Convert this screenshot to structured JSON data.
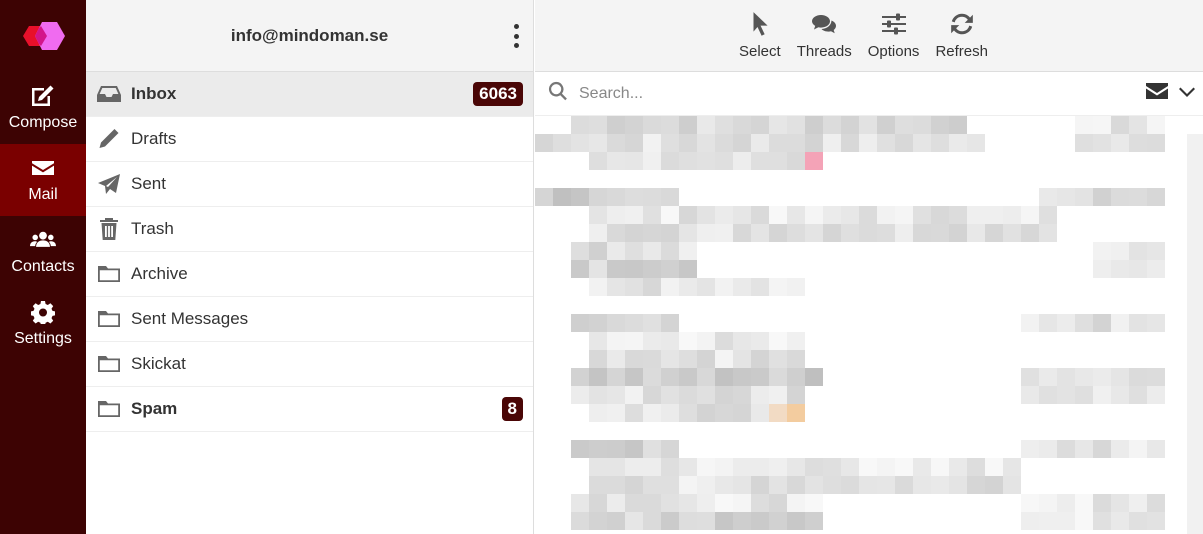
{
  "nav": {
    "items": [
      {
        "label": "Compose",
        "icon": "compose-icon",
        "active": false
      },
      {
        "label": "Mail",
        "icon": "mail-icon",
        "active": true
      },
      {
        "label": "Contacts",
        "icon": "contacts-icon",
        "active": false
      },
      {
        "label": "Settings",
        "icon": "settings-icon",
        "active": false
      }
    ]
  },
  "account": {
    "email": "info@mindoman.se"
  },
  "folders": [
    {
      "name": "Inbox",
      "icon": "inbox-icon",
      "count": "6063",
      "selected": true
    },
    {
      "name": "Drafts",
      "icon": "pencil-icon",
      "count": "",
      "selected": false
    },
    {
      "name": "Sent",
      "icon": "paper-plane-icon",
      "count": "",
      "selected": false
    },
    {
      "name": "Trash",
      "icon": "trash-icon",
      "count": "",
      "selected": false
    },
    {
      "name": "Archive",
      "icon": "folder-icon",
      "count": "",
      "selected": false
    },
    {
      "name": "Sent Messages",
      "icon": "folder-icon",
      "count": "",
      "selected": false
    },
    {
      "name": "Skickat",
      "icon": "folder-icon",
      "count": "",
      "selected": false
    },
    {
      "name": "Spam",
      "icon": "folder-icon",
      "count": "8",
      "selected": false
    }
  ],
  "toolbar": {
    "select_label": "Select",
    "threads_label": "Threads",
    "options_label": "Options",
    "refresh_label": "Refresh"
  },
  "search": {
    "placeholder": "Search..."
  },
  "colors": {
    "nav_bg": "#3d0303",
    "nav_active": "#7a0000",
    "badge_bg": "#4a0606",
    "logo_red": "#e8102a",
    "logo_pink": "#f06bf0"
  }
}
